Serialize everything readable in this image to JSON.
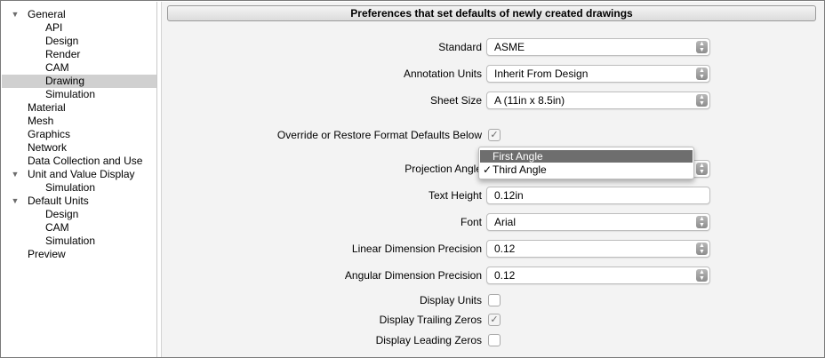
{
  "sidebar": {
    "items": [
      {
        "label": "General",
        "expandable": true
      },
      {
        "label": "API"
      },
      {
        "label": "Design"
      },
      {
        "label": "Render"
      },
      {
        "label": "CAM"
      },
      {
        "label": "Drawing",
        "selected": true
      },
      {
        "label": "Simulation"
      },
      {
        "label": "Material"
      },
      {
        "label": "Mesh"
      },
      {
        "label": "Graphics"
      },
      {
        "label": "Network"
      },
      {
        "label": "Data Collection and Use"
      },
      {
        "label": "Unit and Value Display",
        "expandable": true
      },
      {
        "label": "Simulation"
      },
      {
        "label": "Default Units",
        "expandable": true
      },
      {
        "label": "Design"
      },
      {
        "label": "CAM"
      },
      {
        "label": "Simulation"
      },
      {
        "label": "Preview"
      }
    ]
  },
  "header": {
    "title": "Preferences that set defaults of newly created drawings"
  },
  "form": {
    "standard": {
      "label": "Standard",
      "value": "ASME"
    },
    "annotation_units": {
      "label": "Annotation Units",
      "value": "Inherit From Design"
    },
    "sheet_size": {
      "label": "Sheet Size",
      "value": "A (11in x 8.5in)"
    },
    "override": {
      "label": "Override or Restore Format Defaults Below",
      "checked": true
    },
    "projection_angle": {
      "label": "Projection Angle",
      "options": [
        "First Angle",
        "Third Angle"
      ],
      "selected": "Third Angle",
      "highlighted": "First Angle"
    },
    "text_height": {
      "label": "Text Height",
      "value": "0.12in"
    },
    "font": {
      "label": "Font",
      "value": "Arial"
    },
    "linear_precision": {
      "label": "Linear Dimension Precision",
      "value": "0.12"
    },
    "angular_precision": {
      "label": "Angular Dimension Precision",
      "value": "0.12"
    },
    "display_units": {
      "label": "Display Units",
      "checked": false
    },
    "display_trailing_zeros": {
      "label": "Display Trailing Zeros",
      "checked": true
    },
    "display_leading_zeros": {
      "label": "Display Leading Zeros",
      "checked": false
    }
  },
  "icons": {
    "expand": "triangle-down-icon",
    "stepper": "up-down-stepper-icon",
    "check": "checkmark-icon"
  },
  "colors": {
    "selection": "#d0d0d0",
    "menu_highlight": "#6e6e6e",
    "panel_bg": "#f3f3f3"
  }
}
